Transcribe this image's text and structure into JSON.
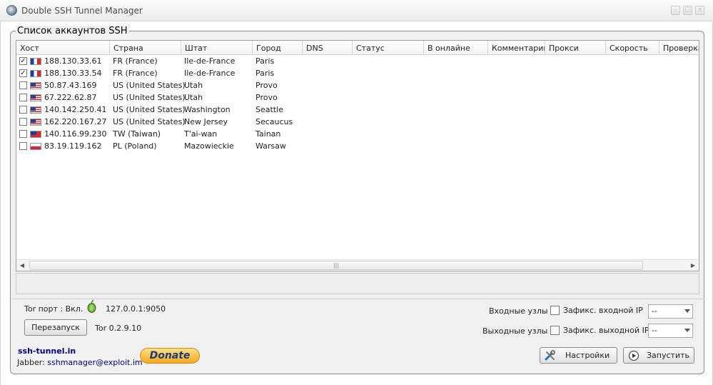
{
  "window": {
    "title": "Double SSH Tunnel Manager"
  },
  "group": {
    "title": "Список аккаунтов SSH"
  },
  "table": {
    "columns": [
      "Хост",
      "Страна",
      "Штат",
      "Город",
      "DNS",
      "Статус",
      "В онлайне",
      "Комментарии",
      "Прокси",
      "Скорость",
      "Проверка"
    ],
    "rows": [
      {
        "checked": true,
        "flag": "fr",
        "host": "188.130.33.61",
        "country": "FR (France)",
        "state": "Ile-de-France",
        "city": "Paris"
      },
      {
        "checked": true,
        "flag": "fr",
        "host": "188.130.33.54",
        "country": "FR (France)",
        "state": "Ile-de-France",
        "city": "Paris"
      },
      {
        "checked": false,
        "flag": "us",
        "host": "50.87.43.169",
        "country": "US (United States)",
        "state": "Utah",
        "city": "Provo"
      },
      {
        "checked": false,
        "flag": "us",
        "host": "67.222.62.87",
        "country": "US (United States)",
        "state": "Utah",
        "city": "Provo"
      },
      {
        "checked": false,
        "flag": "us",
        "host": "140.142.250.41",
        "country": "US (United States)",
        "state": "Washington",
        "city": "Seattle"
      },
      {
        "checked": false,
        "flag": "us",
        "host": "162.220.167.27",
        "country": "US (United States)",
        "state": "New Jersey",
        "city": "Secaucus"
      },
      {
        "checked": false,
        "flag": "tw",
        "host": "140.116.99.230",
        "country": "TW (Taiwan)",
        "state": "T'ai-wan",
        "city": "Tainan"
      },
      {
        "checked": false,
        "flag": "pl",
        "host": "83.19.119.162",
        "country": "PL (Poland)",
        "state": "Mazowieckie",
        "city": "Warsaw"
      }
    ]
  },
  "tor": {
    "port_label": "Tor порт : Вкл.",
    "address": "127.0.0.1:9050",
    "restart_label": "Перезапуск",
    "version": "Tor 0.2.9.10"
  },
  "nodes": {
    "entry_label": "Входные узлы :",
    "entry_fix_label": "Зафикс. входной IP",
    "entry_value": "--",
    "exit_label": "Выходные узлы :",
    "exit_fix_label": "Зафикс. выходной IP",
    "exit_value": "--"
  },
  "footer": {
    "site": "ssh-tunnel.in",
    "jabber_prefix": "Jabber:",
    "jabber": "sshmanager@exploit.im",
    "donate": "Donate",
    "settings_label": "Настройки",
    "start_label": "Запустить"
  },
  "colors": {
    "link": "#000080",
    "accent": "#f7a81b"
  }
}
